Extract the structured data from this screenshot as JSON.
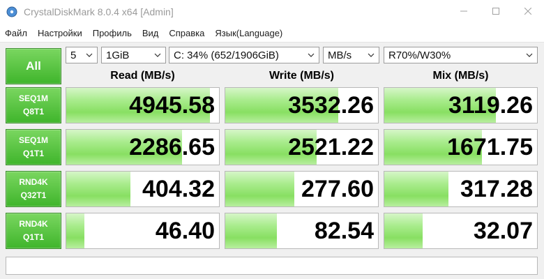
{
  "window": {
    "title": "CrystalDiskMark 8.0.4 x64 [Admin]",
    "icon": "app-disk-icon",
    "controls": [
      "minimize-icon",
      "maximize-icon",
      "close-icon"
    ]
  },
  "menu": {
    "items": [
      "Файл",
      "Настройки",
      "Профиль",
      "Вид",
      "Справка",
      "Язык(Language)"
    ]
  },
  "toolbar": {
    "all_label": "All",
    "count": "5",
    "size": "1GiB",
    "drive": "C: 34% (652/1906GiB)",
    "unit": "MB/s",
    "mix": "R70%/W30%"
  },
  "headers": {
    "read": "Read (MB/s)",
    "write": "Write (MB/s)",
    "mix": "Mix (MB/s)"
  },
  "rows": [
    {
      "line1": "SEQ1M",
      "line2": "Q8T1",
      "read": "4945.58",
      "read_level": 0.94,
      "write": "3532.26",
      "write_level": 0.74,
      "mix": "3119.26",
      "mix_level": 0.73
    },
    {
      "line1": "SEQ1M",
      "line2": "Q1T1",
      "read": "2286.65",
      "read_level": 0.76,
      "write": "2521.22",
      "write_level": 0.6,
      "mix": "1671.75",
      "mix_level": 0.64
    },
    {
      "line1": "RND4K",
      "line2": "Q32T1",
      "read": "404.32",
      "read_level": 0.42,
      "write": "277.60",
      "write_level": 0.45,
      "mix": "317.28",
      "mix_level": 0.42
    },
    {
      "line1": "RND4K",
      "line2": "Q1T1",
      "read": "46.40",
      "read_level": 0.12,
      "write": "82.54",
      "write_level": 0.34,
      "mix": "32.07",
      "mix_level": 0.25
    }
  ],
  "status_text": "",
  "colors": {
    "button_green": "#4cbf36",
    "bar_green": "#8fe26b",
    "background": "#f0f0f0"
  }
}
